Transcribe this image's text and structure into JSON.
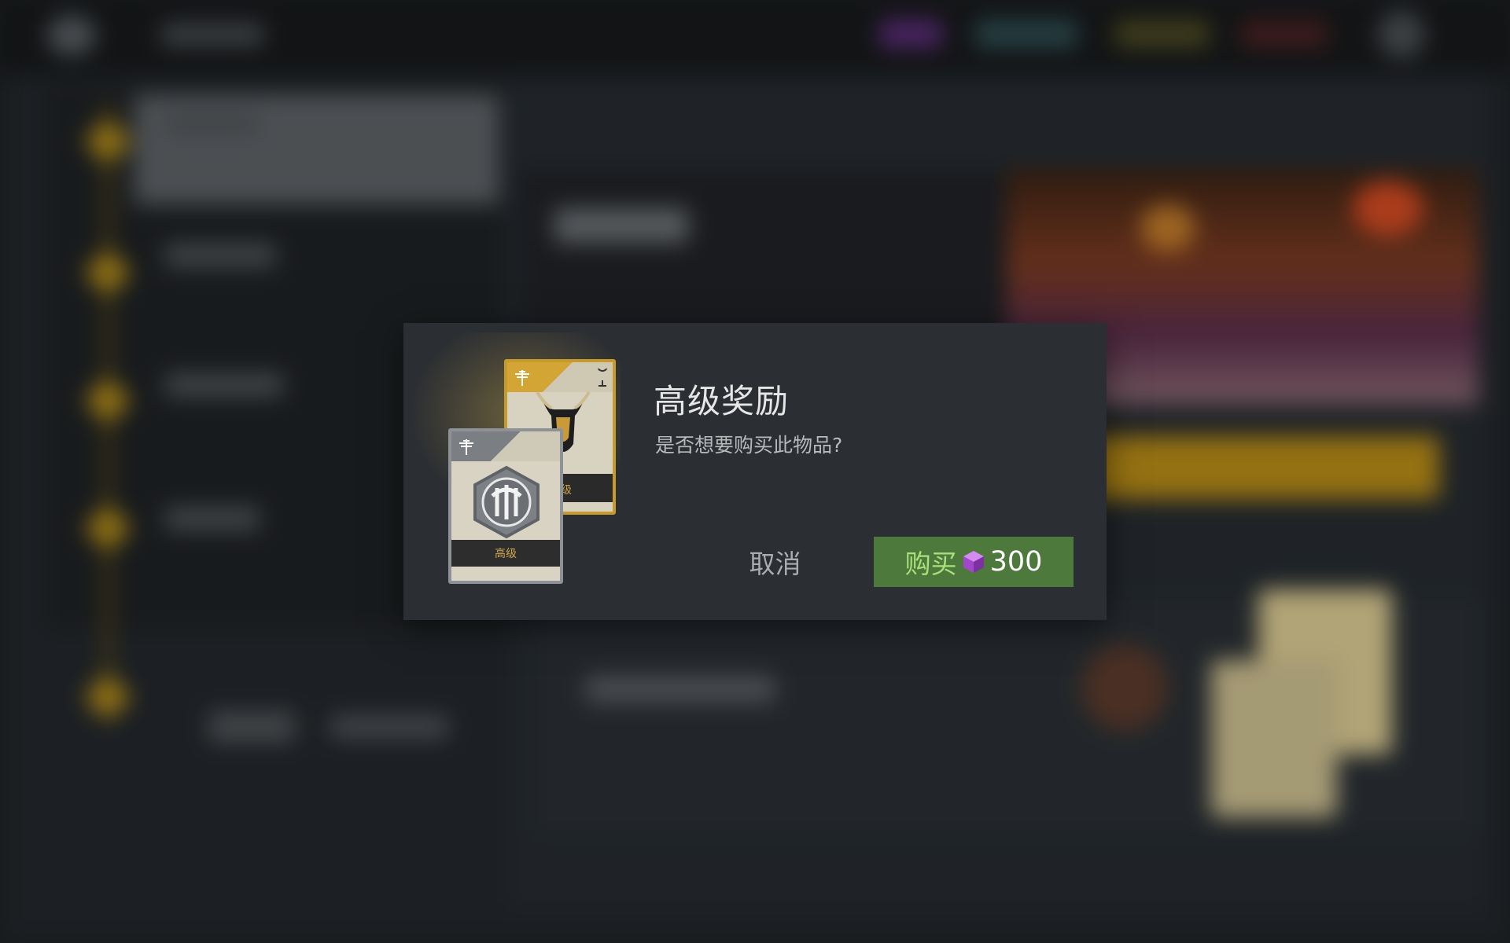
{
  "dialog": {
    "title": "高级奖励",
    "question": "是否想要购买此物品?",
    "cancel_label": "取消",
    "buy_label": "购买",
    "price": "300",
    "currency_icon": "purple-cube-icon"
  },
  "cards": {
    "front_card_tier": "高级",
    "back_card_tier": "级"
  },
  "colors": {
    "dialog_bg": "#2b2e32",
    "buy_button_bg": "#4d7a3c",
    "buy_label": "#a8e07a",
    "gold_card": "#c79a2c",
    "currency": "#b65ad8"
  }
}
